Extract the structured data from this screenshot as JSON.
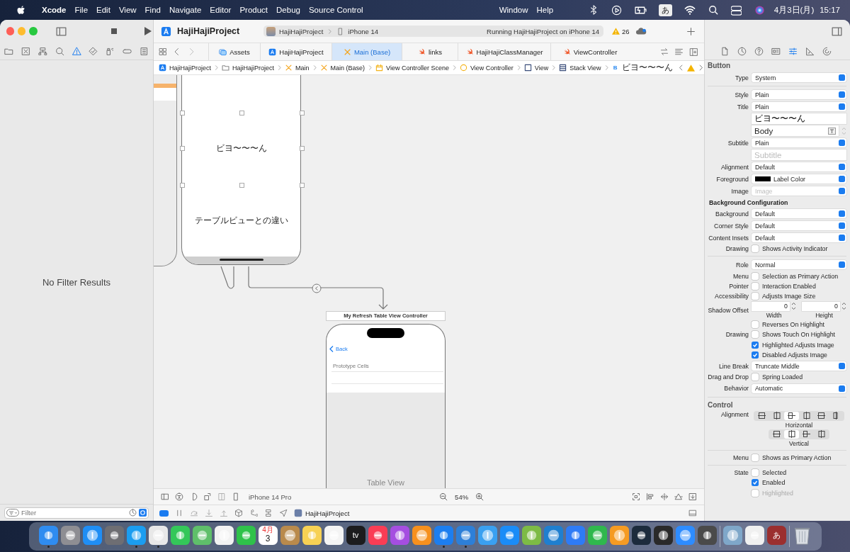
{
  "menubar": {
    "app": "Xcode",
    "menus": [
      "File",
      "Edit",
      "View",
      "Find",
      "Navigate",
      "Editor",
      "Product",
      "Debug",
      "Source Control"
    ],
    "more_menus": [
      "Window",
      "Help"
    ],
    "input_method": "あ",
    "date": "4月3日(月)",
    "time": "15:17"
  },
  "toolbar": {
    "title": "HajiHajiProject",
    "scheme": "HajiHajiProject",
    "device": "iPhone 14",
    "status": "Running HajiHajiProject on iPhone 14",
    "warnings": "26"
  },
  "navigator": {
    "tools": [
      {
        "kind": "folder",
        "selected": false
      },
      {
        "kind": "xbox",
        "selected": false
      },
      {
        "kind": "hierarchy",
        "selected": false
      },
      {
        "kind": "search",
        "selected": false
      },
      {
        "kind": "warning",
        "selected": true
      },
      {
        "kind": "diamond",
        "selected": false
      },
      {
        "kind": "spray",
        "selected": false
      },
      {
        "kind": "capsule",
        "selected": false
      },
      {
        "kind": "list",
        "selected": false
      }
    ],
    "empty_message": "No Filter Results",
    "filter": {
      "placeholder": "Filter"
    }
  },
  "tabs": [
    {
      "label": "Assets",
      "kind": "assets",
      "selected": false
    },
    {
      "label": "HajiHajiProject",
      "kind": "project",
      "selected": false
    },
    {
      "label": "Main (Base)",
      "kind": "storyboard",
      "selected": true
    },
    {
      "label": "links",
      "kind": "swift",
      "selected": false
    },
    {
      "label": "HajiHajiClassManager",
      "kind": "swift",
      "selected": false
    },
    {
      "label": "ViewController",
      "kind": "swift",
      "selected": false
    }
  ],
  "jump_bar": [
    {
      "label": "HajiHajiProject",
      "kind": "project"
    },
    {
      "label": "HajiHajiProject",
      "kind": "folder"
    },
    {
      "label": "Main",
      "kind": "storyboard"
    },
    {
      "label": "Main (Base)",
      "kind": "storyboard"
    },
    {
      "label": "View Controller Scene",
      "kind": "scene"
    },
    {
      "label": "View Controller",
      "kind": "controller"
    },
    {
      "label": "View",
      "kind": "view"
    },
    {
      "label": "Stack View",
      "kind": "stack"
    },
    {
      "label": "ビヨ〜〜〜ん",
      "kind": "button",
      "glyph": "B"
    }
  ],
  "canvas": {
    "scene_labels": [
      "ビヨ〜〜〜ん",
      "テーブルビューとの違い"
    ],
    "table_scene": {
      "title": "My Refresh Table View Controller",
      "back": "Back",
      "section": "Prototype Cells",
      "placeholder": "Table View"
    },
    "device": "iPhone 14 Pro",
    "zoom": "54%"
  },
  "debug_bar": {
    "target": "HajiHajiProject"
  },
  "inspector": {
    "tools": [
      {
        "kind": "doc",
        "selected": false
      },
      {
        "kind": "clock",
        "selected": false
      },
      {
        "kind": "help",
        "selected": false
      },
      {
        "kind": "idcard",
        "selected": false
      },
      {
        "kind": "sliders",
        "selected": true
      },
      {
        "kind": "ruler",
        "selected": false
      },
      {
        "kind": "arrowcircle",
        "selected": false
      }
    ],
    "rows": [
      {
        "kind": "header",
        "text": "Button"
      },
      {
        "kind": "popup",
        "label": "Type",
        "value": "System"
      },
      {
        "kind": "rule"
      },
      {
        "kind": "popup",
        "label": "Style",
        "value": "Plain"
      },
      {
        "kind": "popup",
        "label": "Title",
        "value": "Plain"
      },
      {
        "kind": "field",
        "value": "ビヨ〜〜〜ん"
      },
      {
        "kind": "font",
        "value": "Body"
      },
      {
        "kind": "popup",
        "label": "Subtitle",
        "value": "Plain"
      },
      {
        "kind": "field",
        "placeholder": "Subtitle"
      },
      {
        "kind": "popup",
        "label": "Alignment",
        "value": "Default"
      },
      {
        "kind": "color",
        "label": "Foreground",
        "value": "Label Color",
        "color": "#000000"
      },
      {
        "kind": "popup",
        "label": "Image",
        "placeholder": "Image"
      },
      {
        "kind": "subheader",
        "text": "Background Configuration"
      },
      {
        "kind": "popup",
        "label": "Background",
        "value": "Default"
      },
      {
        "kind": "popup",
        "label": "Corner Style",
        "value": "Default"
      },
      {
        "kind": "popup",
        "label": "Content Insets",
        "value": "Default"
      },
      {
        "kind": "check",
        "label": "Drawing",
        "text": "Shows Activity Indicator",
        "checked": false,
        "disabled": false
      },
      {
        "kind": "rule"
      },
      {
        "kind": "popup",
        "label": "Role",
        "value": "Normal"
      },
      {
        "kind": "check",
        "label": "Menu",
        "text": "Selection as Primary Action",
        "checked": false,
        "disabled": false
      },
      {
        "kind": "check",
        "label": "Pointer",
        "text": "Interaction Enabled",
        "checked": false,
        "disabled": false
      },
      {
        "kind": "check",
        "label": "Accessibility",
        "text": "Adjusts Image Size",
        "checked": false,
        "disabled": false
      },
      {
        "kind": "offset",
        "label": "Shadow Offset",
        "values": [
          "0",
          "0"
        ],
        "captions": [
          "Width",
          "Height"
        ]
      },
      {
        "kind": "check",
        "text": "Reverses On Highlight",
        "checked": false,
        "disabled": false
      },
      {
        "kind": "check",
        "label": "Drawing",
        "text": "Shows Touch On Highlight",
        "checked": false,
        "disabled": false
      },
      {
        "kind": "check",
        "text": "Highlighted Adjusts Image",
        "checked": true,
        "disabled": false
      },
      {
        "kind": "check",
        "text": "Disabled Adjusts Image",
        "checked": true,
        "disabled": false
      },
      {
        "kind": "popup",
        "label": "Line Break",
        "value": "Truncate Middle"
      },
      {
        "kind": "check",
        "label": "Drag and Drop",
        "text": "Spring Loaded",
        "checked": false,
        "disabled": false
      },
      {
        "kind": "popup",
        "label": "Behavior",
        "value": "Automatic"
      },
      {
        "kind": "rule"
      },
      {
        "kind": "header",
        "text": "Control"
      },
      {
        "kind": "segments",
        "label": "Alignment",
        "caption": "Horizontal",
        "segments": [
          {
            "selected": false
          },
          {
            "selected": false
          },
          {
            "selected": true
          },
          {
            "selected": false
          },
          {
            "selected": false
          },
          {
            "selected": false
          }
        ]
      },
      {
        "kind": "segments",
        "caption": "Vertical",
        "segments": [
          {
            "selected": false
          },
          {
            "selected": true
          },
          {
            "selected": false
          },
          {
            "selected": false
          }
        ]
      },
      {
        "kind": "rule"
      },
      {
        "kind": "check",
        "label": "Menu",
        "text": "Shows as Primary Action",
        "checked": false,
        "disabled": false
      },
      {
        "kind": "rule"
      },
      {
        "kind": "check",
        "label": "State",
        "text": "Selected",
        "checked": false,
        "disabled": false
      },
      {
        "kind": "check",
        "text": "Enabled",
        "checked": true,
        "disabled": false
      },
      {
        "kind": "check",
        "text": "Highlighted",
        "checked": false,
        "disabled": true
      }
    ]
  },
  "dock": [
    {
      "kind": "app",
      "color": "#2f8cf0",
      "running": true
    },
    {
      "kind": "app",
      "color": "#8e8e93",
      "running": false
    },
    {
      "kind": "app",
      "color": "#1f8ef5",
      "running": false
    },
    {
      "kind": "app",
      "color": "#6e6e73",
      "running": false
    },
    {
      "kind": "app",
      "color": "#1b9df0",
      "running": true
    },
    {
      "kind": "app",
      "color": "#e8e8e8",
      "running": true
    },
    {
      "kind": "app",
      "color": "#34c759",
      "running": false
    },
    {
      "kind": "app",
      "color": "#5fbf6a",
      "running": false
    },
    {
      "kind": "app",
      "color": "#f2f2f2",
      "running": false
    },
    {
      "kind": "app",
      "color": "#2fc24a",
      "running": false
    },
    {
      "kind": "calendar",
      "month": "4月",
      "day": "3",
      "running": false
    },
    {
      "kind": "app",
      "color": "#b98a4c",
      "running": false
    },
    {
      "kind": "app",
      "color": "#f7d154",
      "running": false
    },
    {
      "kind": "app",
      "color": "#f4f4f4",
      "running": false
    },
    {
      "kind": "label",
      "label": "tv",
      "color": "#1c1c1e",
      "running": false
    },
    {
      "kind": "app",
      "color": "#fa3d55",
      "running": false
    },
    {
      "kind": "app",
      "color": "#a54ee0",
      "running": false
    },
    {
      "kind": "app",
      "color": "#f6901e",
      "running": false
    },
    {
      "kind": "app",
      "color": "#1c7ef0",
      "running": true
    },
    {
      "kind": "app",
      "color": "#2d7fd8",
      "running": true
    },
    {
      "kind": "app",
      "color": "#3aa0f0",
      "running": false
    },
    {
      "kind": "app",
      "color": "#1a8cf7",
      "running": false
    },
    {
      "kind": "app",
      "color": "#7dbb45",
      "running": false
    },
    {
      "kind": "app",
      "color": "#1f7fd0",
      "running": false
    },
    {
      "kind": "app",
      "color": "#2e7bf6",
      "running": false
    },
    {
      "kind": "app",
      "color": "#2fb84d",
      "running": false
    },
    {
      "kind": "app",
      "color": "#f59b23",
      "running": false
    },
    {
      "kind": "app",
      "color": "#1c2b3c",
      "running": false
    },
    {
      "kind": "app",
      "color": "#2a2a2a",
      "running": false
    },
    {
      "kind": "app",
      "color": "#2d8cff",
      "running": false
    },
    {
      "kind": "app",
      "color": "#4a4a4a",
      "running": false
    },
    {
      "kind": "separator"
    },
    {
      "kind": "app",
      "color": "#7fa7c9",
      "running": false
    },
    {
      "kind": "app",
      "color": "#f0f0f0",
      "running": false
    },
    {
      "kind": "label",
      "label": "あ",
      "color": "#9b2f2f",
      "running": false
    },
    {
      "kind": "separator"
    },
    {
      "kind": "trash",
      "running": false
    }
  ]
}
